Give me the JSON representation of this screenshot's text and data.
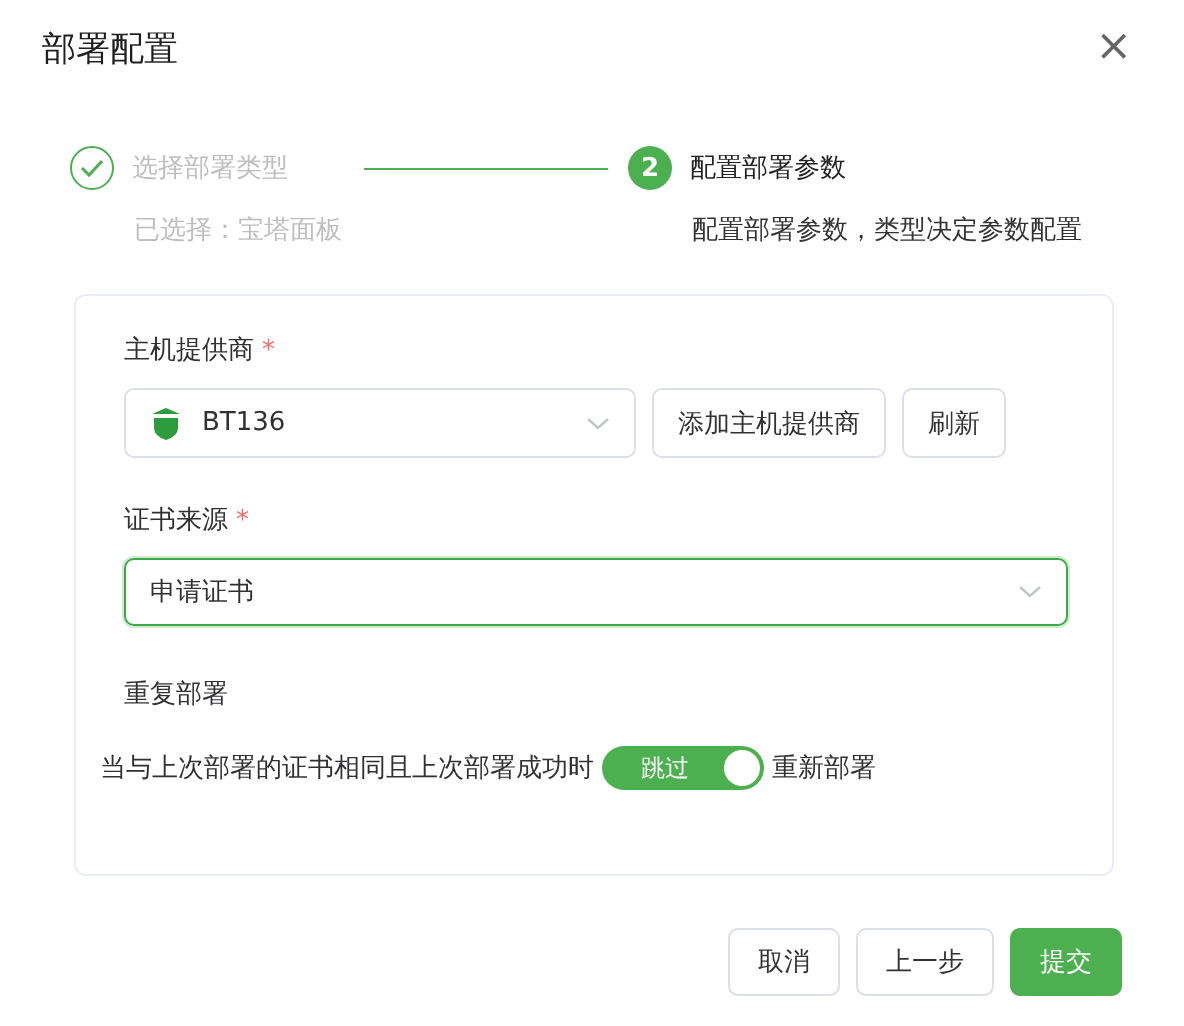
{
  "dialog": {
    "title": "部署配置",
    "close": "×"
  },
  "steps": [
    {
      "title": "选择部署类型",
      "description": "已选择：宝塔面板",
      "completed": true
    },
    {
      "number": "2",
      "title": "配置部署参数",
      "description": "配置部署参数，类型决定参数配置",
      "completed": false
    }
  ],
  "form": {
    "provider": {
      "label": "主机提供商",
      "required_mark": "*",
      "value": "BT136",
      "focused": false,
      "buttons": [
        "添加主机提供商",
        "刷新"
      ]
    },
    "cert_source": {
      "label": "证书来源",
      "required_mark": "*",
      "value": "申请证书",
      "focused": true
    },
    "redeploy": {
      "label": "重复部署",
      "description": "当与上次部署的证书相同且上次部署成功时",
      "switch": {
        "on": true,
        "on_text": "跳过",
        "off_text": "重新部署"
      }
    }
  },
  "footer": {
    "buttons": [
      {
        "label": "取消",
        "kind": "default"
      },
      {
        "label": "上一步",
        "kind": "default"
      },
      {
        "label": "提交",
        "kind": "primary"
      }
    ]
  }
}
